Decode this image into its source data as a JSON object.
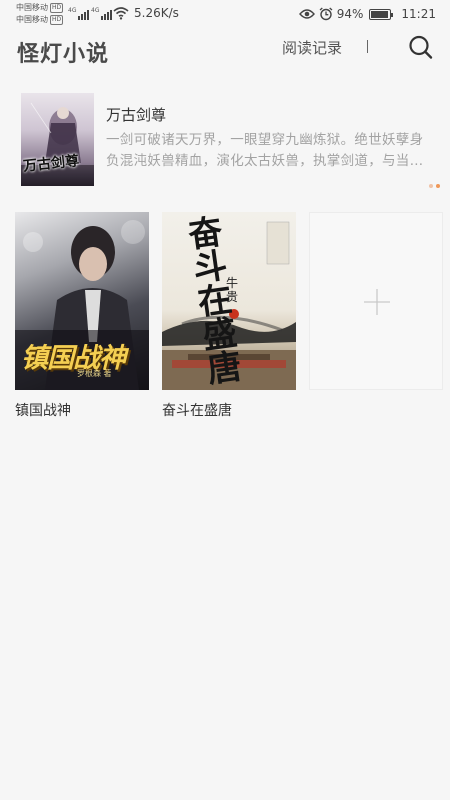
{
  "status_bar": {
    "carrier_1": "中国移动",
    "carrier_2": "中国移动",
    "hd_badge": "HD",
    "net_type": "4G",
    "net_speed": "5.26K/s",
    "battery_percent": "94%",
    "battery_level": 0.94,
    "time": "11:21",
    "icons": [
      "eye-icon",
      "alarm-icon",
      "battery-icon",
      "wifi-icon",
      "signal-icon"
    ]
  },
  "header": {
    "title": "怪灯小说",
    "history_label": "阅读记录",
    "search_icon": "search-icon"
  },
  "featured": {
    "title": "万古剑尊",
    "description": "一剑可破诸天万界，一眼望穿九幽炼狱。绝世妖孽身负混沌妖兽精血，演化太古妖兽，执掌剑道，与当…",
    "cover_text": "万古剑尊"
  },
  "books": [
    {
      "title": "镇国战神",
      "cover_title": "镇国战神",
      "cover_author": "罗根森 著"
    },
    {
      "title": "奋斗在盛唐",
      "cover_title": "奋斗在盛唐",
      "cover_author": "牛贵"
    }
  ],
  "add_book": {
    "icon": "plus-icon"
  },
  "colors": {
    "background": "#f6f6f6",
    "dot_inactive": "#f0c3a6",
    "dot_active": "#ef9858",
    "description": "#a3a3a3"
  }
}
